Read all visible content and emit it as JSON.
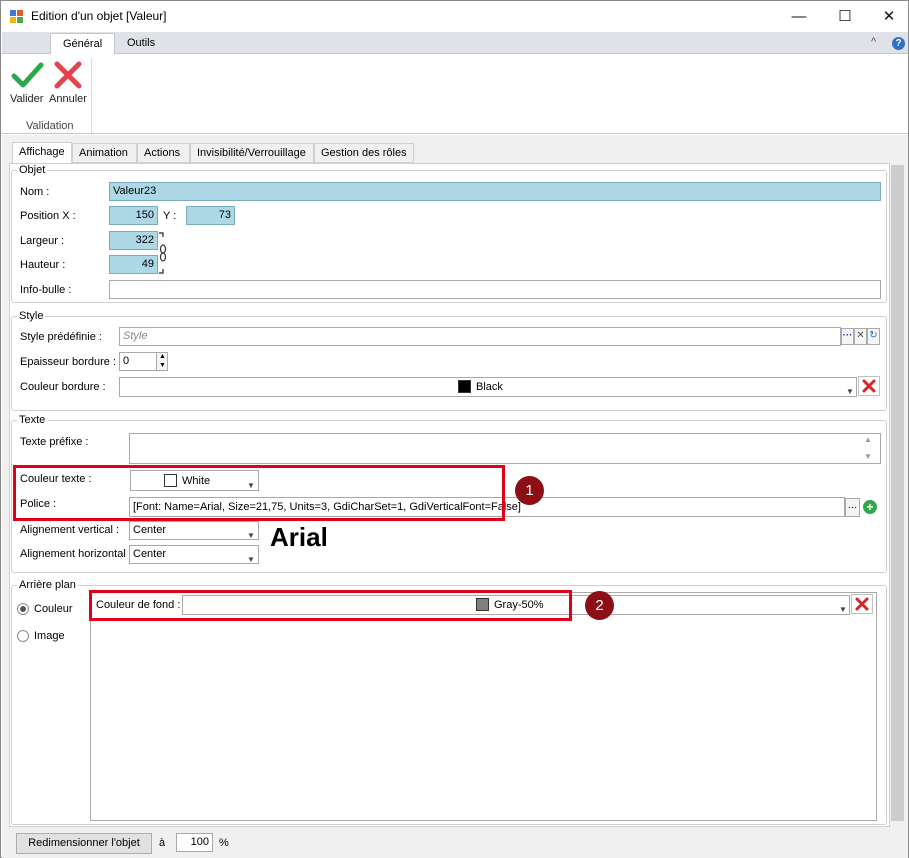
{
  "window": {
    "title": "Edition d'un objet [Valeur]",
    "minimize": "—",
    "maximize": "☐",
    "close": "✕"
  },
  "ribbon": {
    "tabs": [
      {
        "label": "Général",
        "active": true
      },
      {
        "label": "Outils",
        "active": false
      }
    ],
    "valider_label": "Valider",
    "annuler_label": "Annuler",
    "group_label": "Validation",
    "collapse_glyph": "^",
    "help_glyph": "?"
  },
  "tabs": [
    {
      "label": "Affichage",
      "active": true
    },
    {
      "label": "Animation",
      "active": false
    },
    {
      "label": "Actions",
      "active": false
    },
    {
      "label": "Invisibilité/Verrouillage",
      "active": false
    },
    {
      "label": "Gestion des rôles",
      "active": false
    }
  ],
  "objet": {
    "legend": "Objet",
    "nom_label": "Nom :",
    "nom_value": "Valeur23",
    "posx_label": "Position X :",
    "posx_value": "150",
    "y_label": "Y :",
    "y_value": "73",
    "largeur_label": "Largeur :",
    "largeur_value": "322",
    "hauteur_label": "Hauteur :",
    "hauteur_value": "49",
    "infobulle_label": "Info-bulle :",
    "infobulle_value": ""
  },
  "style": {
    "legend": "Style",
    "predef_label": "Style prédéfinie :",
    "predef_placeholder": "Style",
    "epaisseur_label": "Epaisseur bordure :",
    "epaisseur_value": "0",
    "couleur_label": "Couleur bordure :",
    "couleur_value": "Black",
    "couleur_hex": "#000000"
  },
  "texte": {
    "legend": "Texte",
    "prefixe_label": "Texte préfixe :",
    "prefixe_value": "",
    "couleur_label": "Couleur texte :",
    "couleur_value": "White",
    "couleur_hex": "#ffffff",
    "police_label": "Police :",
    "police_value": "[Font: Name=Arial, Size=21,75, Units=3, GdiCharSet=1, GdiVerticalFont=False]",
    "valign_label": "Alignement vertical :",
    "valign_value": "Center",
    "halign_label": "Alignement horizontal :",
    "halign_value": "Center",
    "preview_text": "Arial"
  },
  "arriere_plan": {
    "legend": "Arrière plan",
    "option_couleur": "Couleur",
    "option_image": "Image",
    "selected": "Couleur",
    "couleur_fond_label": "Couleur de fond :",
    "couleur_fond_value": "Gray-50%",
    "couleur_fond_hex": "#808080"
  },
  "footer": {
    "resize_button": "Redimensionner l'objet",
    "a_label": "à",
    "percent_value": "100",
    "percent_label": "%"
  },
  "callouts": [
    "1",
    "2"
  ],
  "colors": {
    "accent_highlight": "#e1001a",
    "badge": "#8b0f14",
    "input_blue": "#add8e6"
  }
}
